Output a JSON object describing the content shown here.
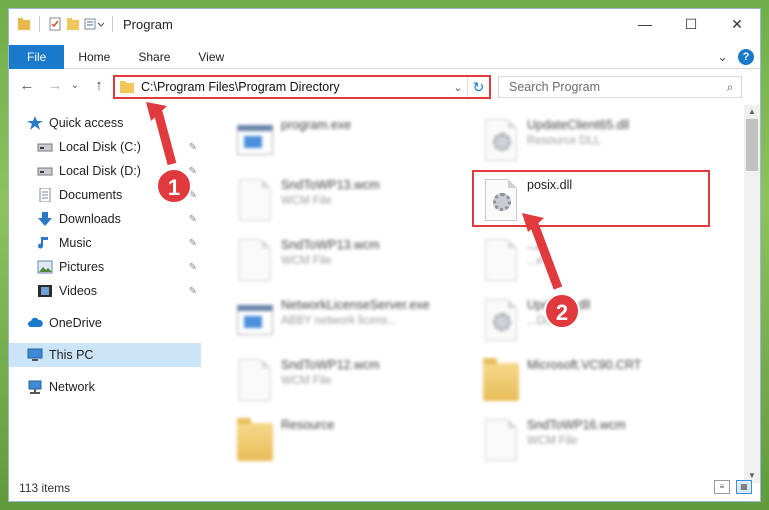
{
  "window": {
    "title": "Program",
    "controls": {
      "minimize": "—",
      "maximize": "☐",
      "close": "✕"
    }
  },
  "ribbon": {
    "tabs": [
      "File",
      "Home",
      "Share",
      "View"
    ],
    "help": "?",
    "expand": "⌄"
  },
  "nav": {
    "back": "←",
    "forward": "→",
    "history": "⌄",
    "up": "↑",
    "address": "C:\\Program Files\\Program Directory",
    "address_dropdown": "⌄",
    "refresh": "↻",
    "search_placeholder": "Search Program",
    "search_icon": "⌕"
  },
  "sidebar": {
    "items": [
      {
        "label": "Quick access",
        "icon": "star-icon",
        "pinned": false
      },
      {
        "label": "Local Disk (C:)",
        "icon": "drive-icon",
        "pinned": true
      },
      {
        "label": "Local Disk (D:)",
        "icon": "drive-icon",
        "pinned": true
      },
      {
        "label": "Documents",
        "icon": "documents-icon",
        "pinned": true
      },
      {
        "label": "Downloads",
        "icon": "download-icon",
        "pinned": true
      },
      {
        "label": "Music",
        "icon": "music-icon",
        "pinned": true
      },
      {
        "label": "Pictures",
        "icon": "pictures-icon",
        "pinned": true
      },
      {
        "label": "Videos",
        "icon": "videos-icon",
        "pinned": true
      },
      {
        "label": "OneDrive",
        "icon": "cloud-icon",
        "pinned": false
      },
      {
        "label": "This PC",
        "icon": "computer-icon",
        "pinned": false,
        "selected": true
      },
      {
        "label": "Network",
        "icon": "network-icon",
        "pinned": false
      }
    ],
    "pin_glyph": "📌"
  },
  "files": [
    {
      "name": "program.exe",
      "type": "",
      "icon": "exe",
      "blurred": true
    },
    {
      "name": "UpdateClient65.dll",
      "type": "Resource DLL",
      "icon": "dll",
      "blurred": true
    },
    {
      "name": "SndToWP13.wcm",
      "type": "WCM File",
      "icon": "doc",
      "blurred": true
    },
    {
      "name": "posix.dll",
      "type": "",
      "icon": "dll",
      "blurred": false
    },
    {
      "name": "SndToWP13.wcm",
      "type": "WCM File",
      "icon": "doc",
      "blurred": true
    },
    {
      "name": "...A",
      "type": "...e",
      "icon": "doc",
      "blurred": true
    },
    {
      "name": "NetworkLicenseServer.exe",
      "type": "ABBY network licens...",
      "icon": "exe",
      "blurred": true
    },
    {
      "name": "Upd...42.dll",
      "type": "...DLL",
      "icon": "dll",
      "blurred": true
    },
    {
      "name": "SndToWP12.wcm",
      "type": "WCM File",
      "icon": "doc",
      "blurred": true
    },
    {
      "name": "Microsoft.VC90.CRT",
      "type": "",
      "icon": "folder",
      "blurred": true
    },
    {
      "name": "Resource",
      "type": "",
      "icon": "folder",
      "blurred": true
    },
    {
      "name": "SndToWP16.wcm",
      "type": "WCM File",
      "icon": "doc",
      "blurred": true
    }
  ],
  "status": {
    "item_count": "113 items"
  },
  "annotations": {
    "step1": "1",
    "step2": "2"
  },
  "colors": {
    "accent": "#1979ca",
    "annotation": "#e0393e"
  }
}
